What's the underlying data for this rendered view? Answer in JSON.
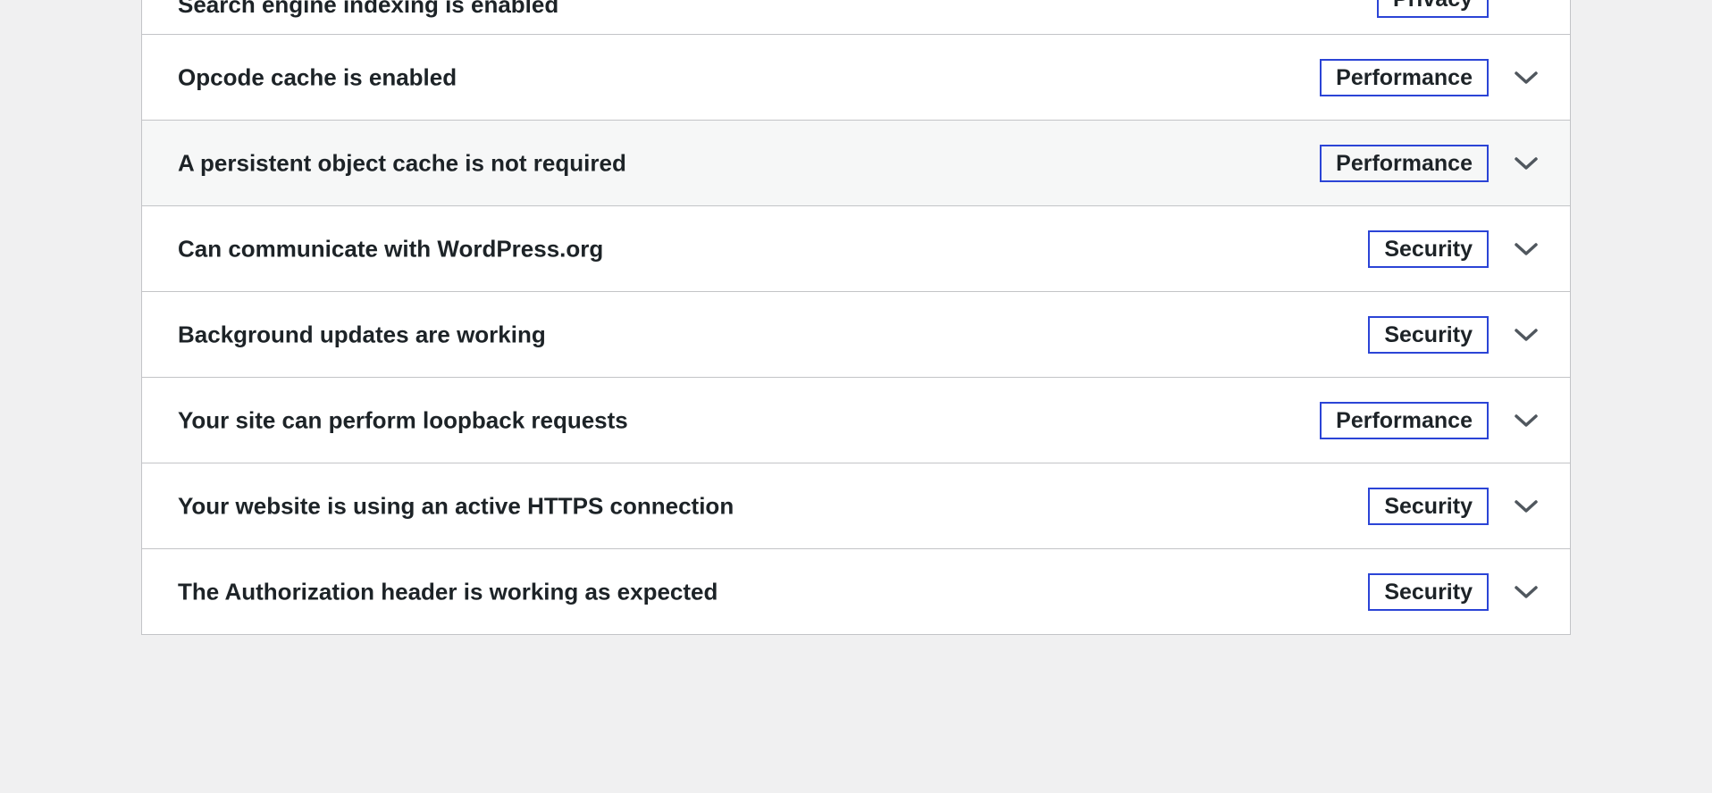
{
  "colors": {
    "page_background": "#f0f0f1",
    "panel_background": "#ffffff",
    "hover_row_background": "#f6f7f7",
    "badge_border": "#2b44d6",
    "text": "#1d2327"
  },
  "partial_item": {
    "label": "Search engine indexing is enabled",
    "badge": "Privacy"
  },
  "items": [
    {
      "label": "Opcode cache is enabled",
      "badge": "Performance",
      "icon": "chevron-down-icon"
    },
    {
      "label": "A persistent object cache is not required",
      "badge": "Performance",
      "icon": "chevron-down-icon"
    },
    {
      "label": "Can communicate with WordPress.org",
      "badge": "Security",
      "icon": "chevron-down-icon"
    },
    {
      "label": "Background updates are working",
      "badge": "Security",
      "icon": "chevron-down-icon"
    },
    {
      "label": "Your site can perform loopback requests",
      "badge": "Performance",
      "icon": "chevron-down-icon"
    },
    {
      "label": "Your website is using an active HTTPS connection",
      "badge": "Security",
      "icon": "chevron-down-icon"
    },
    {
      "label": "The Authorization header is working as expected",
      "badge": "Security",
      "icon": "chevron-down-icon"
    }
  ]
}
